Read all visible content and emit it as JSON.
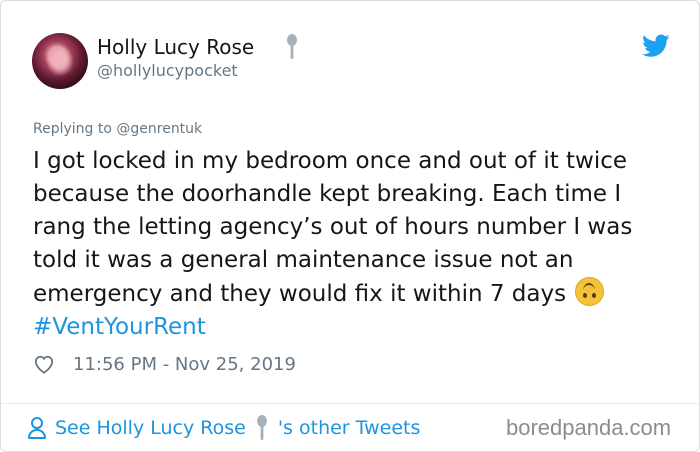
{
  "tweet": {
    "author": {
      "display_name": "Holly Lucy Rose",
      "handle": "@hollylucypocket",
      "name_emoji_icon": "spoon-icon"
    },
    "replying_to": "Replying to @genrentuk",
    "text_lines": [
      "I got locked in my bedroom once and out of it twice",
      "because the doorhandle kept breaking. Each time I",
      "rang the letting agency’s out of hours number I was",
      "told it was a general maintenance issue not an",
      "emergency and they would fix it within 7 days"
    ],
    "emoji_icon": "upside-down-face-icon",
    "hashtag": "#VentYourRent",
    "timestamp": "11:56 PM - Nov 25, 2019",
    "like_icon": "heart-outline-icon",
    "platform_icon": "twitter-bird-icon"
  },
  "footer": {
    "see_prefix": "See Holly Lucy Rose",
    "see_suffix": "'s other Tweets",
    "person_icon": "person-icon"
  },
  "watermark": "boredpanda.com",
  "colors": {
    "link": "#1b95e0",
    "muted": "#657786",
    "text": "#14171a",
    "border": "#d9dee3"
  }
}
